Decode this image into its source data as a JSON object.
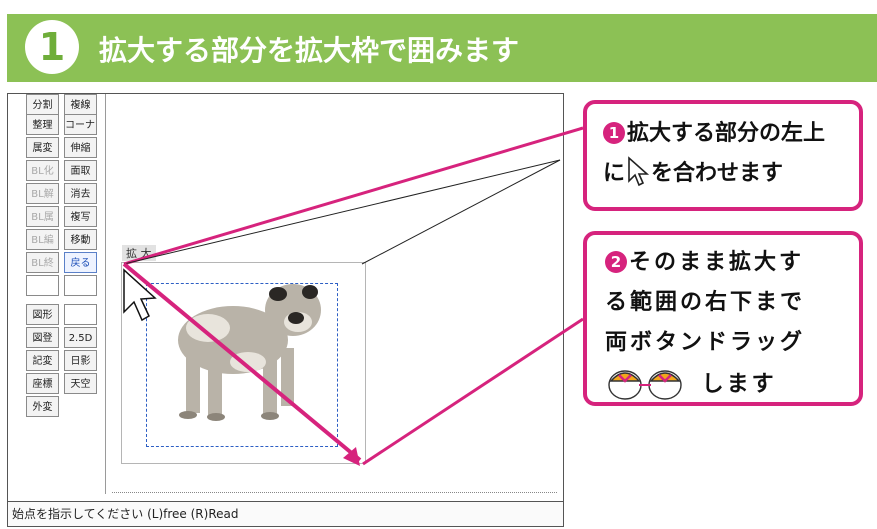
{
  "step": {
    "number": "1",
    "title": "拡大する部分を拡大枠で囲みます"
  },
  "toolbar": {
    "col1": [
      "分割",
      "整理",
      "属変",
      "BL化",
      "BL解",
      "BL属",
      "BL編",
      "BL終",
      "",
      "図形",
      "図登",
      "記変",
      "座標",
      "外変"
    ],
    "col2": [
      "複線",
      "コーナー",
      "伸縮",
      "面取",
      "消去",
      "複写",
      "移動",
      "戻る",
      "",
      "",
      "2.5D",
      "日影",
      "天空"
    ]
  },
  "canvas": {
    "zoom_label": "拡 大"
  },
  "status": {
    "text": "始点を指示してください (L)free (R)Read"
  },
  "callouts": {
    "c1": {
      "badge": "1",
      "line1": "拡大する部分の左上",
      "line2_a": "に",
      "line2_b": "を合わせます"
    },
    "c2": {
      "badge": "2",
      "line1": "そのまま拡大す",
      "line2": "る範囲の右下まで",
      "line3": "両ボタンドラッグ",
      "line4": "します"
    }
  },
  "colors": {
    "banner": "#8cc155",
    "accent": "#d6237d",
    "selection": "#2d5fc4"
  }
}
